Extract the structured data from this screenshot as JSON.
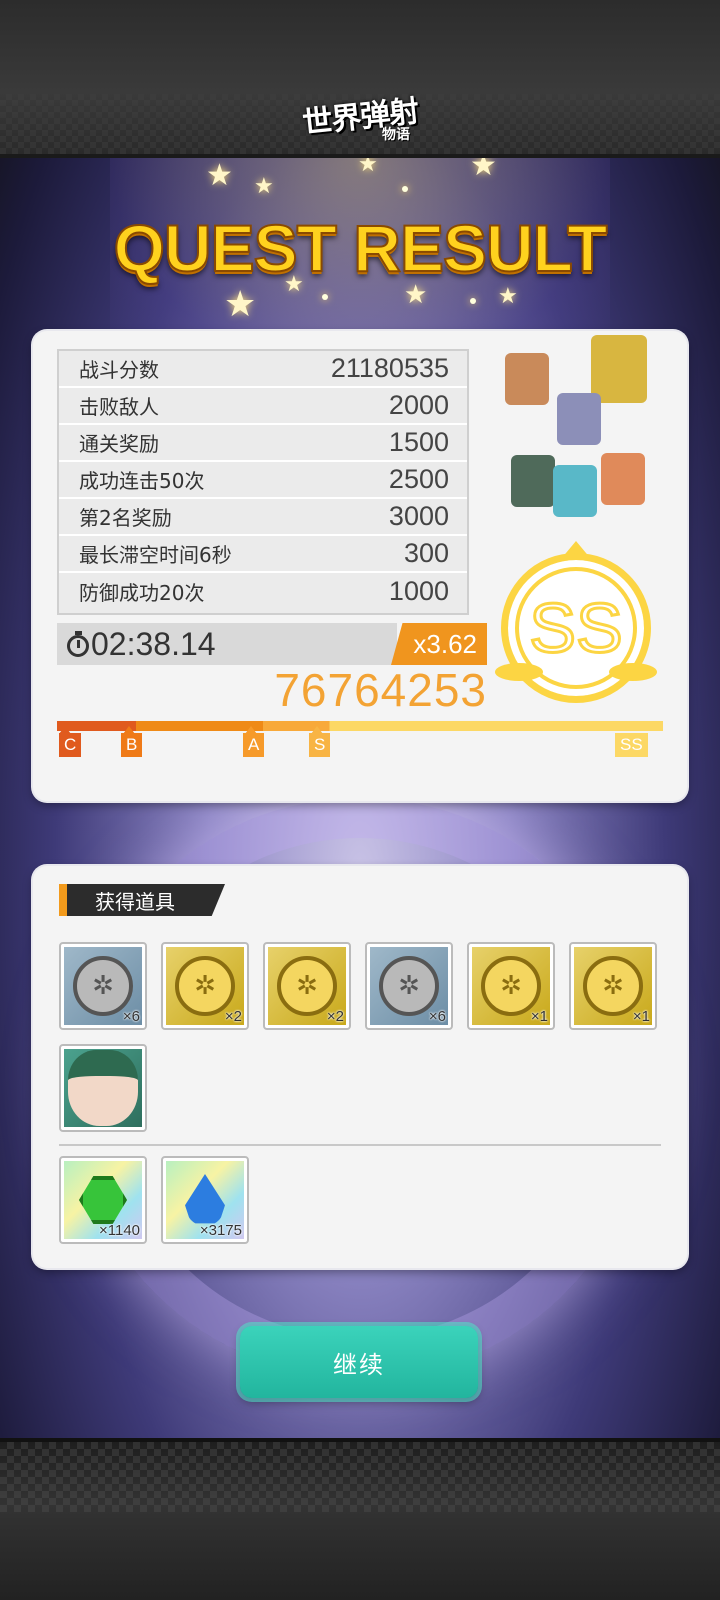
{
  "header": {
    "logo_text": "世界弹射",
    "logo_sub": "物语"
  },
  "title": "QUEST RESULT",
  "score": {
    "rows": [
      {
        "label": "战斗分数",
        "value": "21180535"
      },
      {
        "label": "击败敌人",
        "value": "2000"
      },
      {
        "label": "通关奖励",
        "value": "1500"
      },
      {
        "label": "成功连击50次",
        "value": "2500"
      },
      {
        "label": "第2名奖励",
        "value": "3000"
      },
      {
        "label": "最长滞空时间6秒",
        "value": "300"
      },
      {
        "label": "防御成功20次",
        "value": "1000"
      }
    ],
    "time": "02:38.14",
    "multiplier": "x3.62",
    "total": "76764253",
    "rank": "SS",
    "rank_marks": [
      "C",
      "B",
      "A",
      "S",
      "SS"
    ],
    "rank_progress": 1.0
  },
  "items": {
    "section_title": "获得道具",
    "row1": [
      {
        "icon": "silver-medal-icon",
        "count": "×6"
      },
      {
        "icon": "gold-medal-icon",
        "count": "×2"
      },
      {
        "icon": "gold-medal-icon",
        "count": "×2"
      },
      {
        "icon": "silver-medal-icon",
        "count": "×6"
      },
      {
        "icon": "gold-medal-icon",
        "count": "×1"
      },
      {
        "icon": "gold-medal-icon",
        "count": "×1"
      }
    ],
    "row2": [
      {
        "icon": "character-portrait-icon"
      }
    ],
    "currency": [
      {
        "icon": "green-gem-icon",
        "count": "×1140"
      },
      {
        "icon": "blue-drop-icon",
        "count": "×3175"
      }
    ]
  },
  "continue_label": "继续",
  "colors": {
    "accent_orange": "#f29a1c",
    "rank_gold": "#fcd543",
    "button_teal": "#2cc4ac"
  }
}
